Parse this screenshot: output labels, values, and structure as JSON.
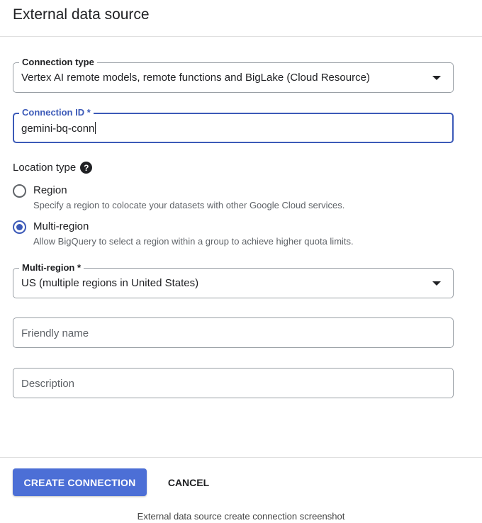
{
  "header": {
    "title": "External data source"
  },
  "connection_type": {
    "label": "Connection type",
    "value": "Vertex AI remote models, remote functions and BigLake (Cloud Resource)"
  },
  "connection_id": {
    "label": "Connection ID *",
    "value": "gemini-bq-conn"
  },
  "location_type": {
    "heading": "Location type",
    "help_icon": "?",
    "options": [
      {
        "label": "Region",
        "description": "Specify a region to colocate your datasets with other Google Cloud services.",
        "checked": false
      },
      {
        "label": "Multi-region",
        "description": "Allow BigQuery to select a region within a group to achieve higher quota limits.",
        "checked": true
      }
    ]
  },
  "multi_region": {
    "label": "Multi-region *",
    "value": "US (multiple regions in United States)"
  },
  "friendly_name": {
    "placeholder": "Friendly name"
  },
  "description": {
    "placeholder": "Description"
  },
  "actions": {
    "create_label": "CREATE CONNECTION",
    "cancel_label": "CANCEL"
  },
  "caption": "External data source create connection screenshot",
  "colors": {
    "accent": "#3c5ab8",
    "primary_button": "#4c6fd6"
  }
}
